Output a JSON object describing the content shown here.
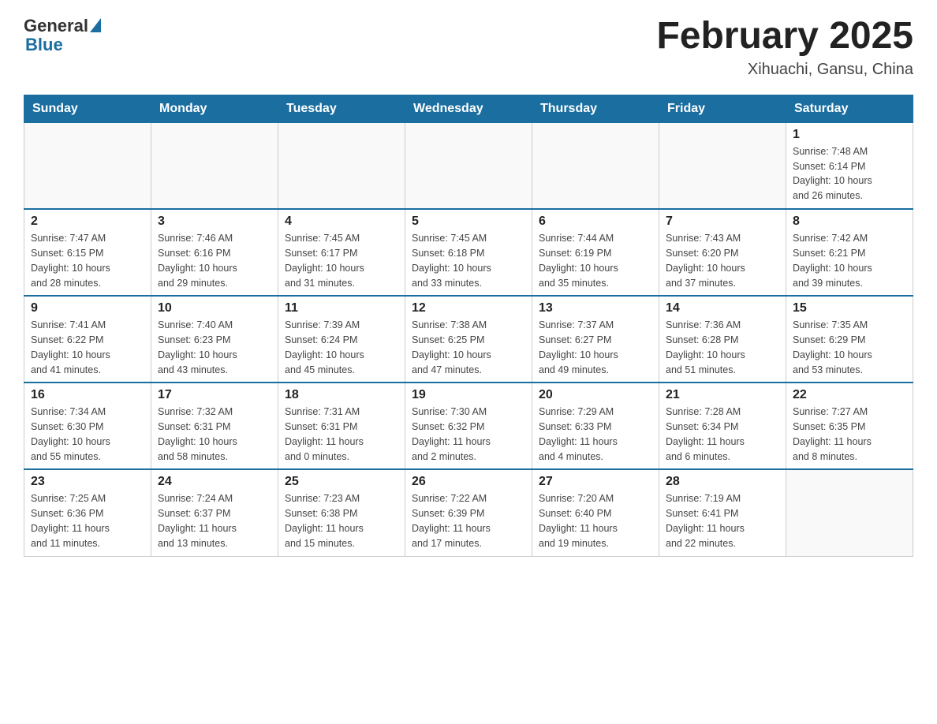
{
  "logo": {
    "general": "General",
    "blue": "Blue"
  },
  "title": "February 2025",
  "location": "Xihuachi, Gansu, China",
  "weekdays": [
    "Sunday",
    "Monday",
    "Tuesday",
    "Wednesday",
    "Thursday",
    "Friday",
    "Saturday"
  ],
  "weeks": [
    [
      {
        "day": "",
        "info": ""
      },
      {
        "day": "",
        "info": ""
      },
      {
        "day": "",
        "info": ""
      },
      {
        "day": "",
        "info": ""
      },
      {
        "day": "",
        "info": ""
      },
      {
        "day": "",
        "info": ""
      },
      {
        "day": "1",
        "info": "Sunrise: 7:48 AM\nSunset: 6:14 PM\nDaylight: 10 hours\nand 26 minutes."
      }
    ],
    [
      {
        "day": "2",
        "info": "Sunrise: 7:47 AM\nSunset: 6:15 PM\nDaylight: 10 hours\nand 28 minutes."
      },
      {
        "day": "3",
        "info": "Sunrise: 7:46 AM\nSunset: 6:16 PM\nDaylight: 10 hours\nand 29 minutes."
      },
      {
        "day": "4",
        "info": "Sunrise: 7:45 AM\nSunset: 6:17 PM\nDaylight: 10 hours\nand 31 minutes."
      },
      {
        "day": "5",
        "info": "Sunrise: 7:45 AM\nSunset: 6:18 PM\nDaylight: 10 hours\nand 33 minutes."
      },
      {
        "day": "6",
        "info": "Sunrise: 7:44 AM\nSunset: 6:19 PM\nDaylight: 10 hours\nand 35 minutes."
      },
      {
        "day": "7",
        "info": "Sunrise: 7:43 AM\nSunset: 6:20 PM\nDaylight: 10 hours\nand 37 minutes."
      },
      {
        "day": "8",
        "info": "Sunrise: 7:42 AM\nSunset: 6:21 PM\nDaylight: 10 hours\nand 39 minutes."
      }
    ],
    [
      {
        "day": "9",
        "info": "Sunrise: 7:41 AM\nSunset: 6:22 PM\nDaylight: 10 hours\nand 41 minutes."
      },
      {
        "day": "10",
        "info": "Sunrise: 7:40 AM\nSunset: 6:23 PM\nDaylight: 10 hours\nand 43 minutes."
      },
      {
        "day": "11",
        "info": "Sunrise: 7:39 AM\nSunset: 6:24 PM\nDaylight: 10 hours\nand 45 minutes."
      },
      {
        "day": "12",
        "info": "Sunrise: 7:38 AM\nSunset: 6:25 PM\nDaylight: 10 hours\nand 47 minutes."
      },
      {
        "day": "13",
        "info": "Sunrise: 7:37 AM\nSunset: 6:27 PM\nDaylight: 10 hours\nand 49 minutes."
      },
      {
        "day": "14",
        "info": "Sunrise: 7:36 AM\nSunset: 6:28 PM\nDaylight: 10 hours\nand 51 minutes."
      },
      {
        "day": "15",
        "info": "Sunrise: 7:35 AM\nSunset: 6:29 PM\nDaylight: 10 hours\nand 53 minutes."
      }
    ],
    [
      {
        "day": "16",
        "info": "Sunrise: 7:34 AM\nSunset: 6:30 PM\nDaylight: 10 hours\nand 55 minutes."
      },
      {
        "day": "17",
        "info": "Sunrise: 7:32 AM\nSunset: 6:31 PM\nDaylight: 10 hours\nand 58 minutes."
      },
      {
        "day": "18",
        "info": "Sunrise: 7:31 AM\nSunset: 6:31 PM\nDaylight: 11 hours\nand 0 minutes."
      },
      {
        "day": "19",
        "info": "Sunrise: 7:30 AM\nSunset: 6:32 PM\nDaylight: 11 hours\nand 2 minutes."
      },
      {
        "day": "20",
        "info": "Sunrise: 7:29 AM\nSunset: 6:33 PM\nDaylight: 11 hours\nand 4 minutes."
      },
      {
        "day": "21",
        "info": "Sunrise: 7:28 AM\nSunset: 6:34 PM\nDaylight: 11 hours\nand 6 minutes."
      },
      {
        "day": "22",
        "info": "Sunrise: 7:27 AM\nSunset: 6:35 PM\nDaylight: 11 hours\nand 8 minutes."
      }
    ],
    [
      {
        "day": "23",
        "info": "Sunrise: 7:25 AM\nSunset: 6:36 PM\nDaylight: 11 hours\nand 11 minutes."
      },
      {
        "day": "24",
        "info": "Sunrise: 7:24 AM\nSunset: 6:37 PM\nDaylight: 11 hours\nand 13 minutes."
      },
      {
        "day": "25",
        "info": "Sunrise: 7:23 AM\nSunset: 6:38 PM\nDaylight: 11 hours\nand 15 minutes."
      },
      {
        "day": "26",
        "info": "Sunrise: 7:22 AM\nSunset: 6:39 PM\nDaylight: 11 hours\nand 17 minutes."
      },
      {
        "day": "27",
        "info": "Sunrise: 7:20 AM\nSunset: 6:40 PM\nDaylight: 11 hours\nand 19 minutes."
      },
      {
        "day": "28",
        "info": "Sunrise: 7:19 AM\nSunset: 6:41 PM\nDaylight: 11 hours\nand 22 minutes."
      },
      {
        "day": "",
        "info": ""
      }
    ]
  ]
}
